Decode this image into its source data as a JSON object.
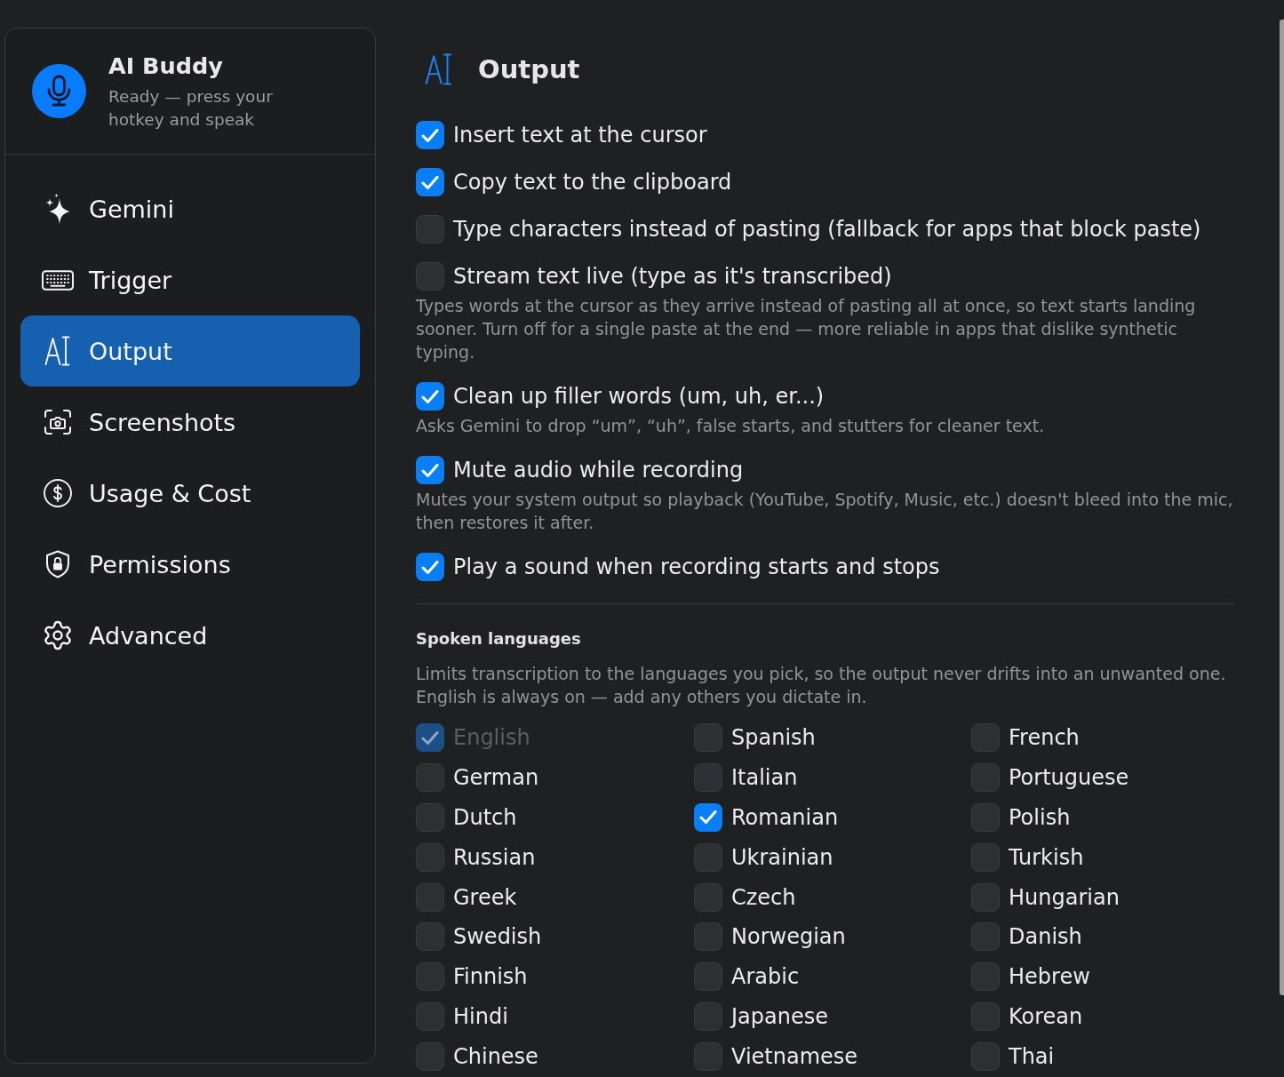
{
  "app": {
    "title": "AI Buddy",
    "status": "Ready — press your hotkey and speak"
  },
  "sidebar": {
    "items": [
      {
        "label": "Gemini",
        "selected": false
      },
      {
        "label": "Trigger",
        "selected": false
      },
      {
        "label": "Output",
        "selected": true
      },
      {
        "label": "Screenshots",
        "selected": false
      },
      {
        "label": "Usage & Cost",
        "selected": false
      },
      {
        "label": "Permissions",
        "selected": false
      },
      {
        "label": "Advanced",
        "selected": false
      }
    ]
  },
  "page": {
    "title": "Output"
  },
  "options": [
    {
      "label": "Insert text at the cursor",
      "checked": true
    },
    {
      "label": "Copy text to the clipboard",
      "checked": true
    },
    {
      "label": "Type characters instead of pasting (fallback for apps that block paste)",
      "checked": false
    },
    {
      "label": "Stream text live (type as it's transcribed)",
      "checked": false,
      "description": "Types words at the cursor as they arrive instead of pasting all at once, so text starts landing sooner. Turn off for a single paste at the end — more reliable in apps that dislike synthetic typing."
    },
    {
      "label": "Clean up filler words (um, uh, er...)",
      "checked": true,
      "description": "Asks Gemini to drop “um”, “uh”, false starts, and stutters for cleaner text."
    },
    {
      "label": "Mute audio while recording",
      "checked": true,
      "description": "Mutes your system output so playback (YouTube, Spotify, Music, etc.) doesn't bleed into the mic, then restores it after."
    },
    {
      "label": "Play a sound when recording starts and stops",
      "checked": true
    }
  ],
  "languages": {
    "title": "Spoken languages",
    "description": "Limits transcription to the languages you pick, so the output never drifts into an unwanted one. English is always on — add any others you dictate in.",
    "items": [
      {
        "label": "English",
        "checked": true,
        "disabled": true
      },
      {
        "label": "Spanish",
        "checked": false,
        "disabled": false
      },
      {
        "label": "French",
        "checked": false,
        "disabled": false
      },
      {
        "label": "German",
        "checked": false,
        "disabled": false
      },
      {
        "label": "Italian",
        "checked": false,
        "disabled": false
      },
      {
        "label": "Portuguese",
        "checked": false,
        "disabled": false
      },
      {
        "label": "Dutch",
        "checked": false,
        "disabled": false
      },
      {
        "label": "Romanian",
        "checked": true,
        "disabled": false
      },
      {
        "label": "Polish",
        "checked": false,
        "disabled": false
      },
      {
        "label": "Russian",
        "checked": false,
        "disabled": false
      },
      {
        "label": "Ukrainian",
        "checked": false,
        "disabled": false
      },
      {
        "label": "Turkish",
        "checked": false,
        "disabled": false
      },
      {
        "label": "Greek",
        "checked": false,
        "disabled": false
      },
      {
        "label": "Czech",
        "checked": false,
        "disabled": false
      },
      {
        "label": "Hungarian",
        "checked": false,
        "disabled": false
      },
      {
        "label": "Swedish",
        "checked": false,
        "disabled": false
      },
      {
        "label": "Norwegian",
        "checked": false,
        "disabled": false
      },
      {
        "label": "Danish",
        "checked": false,
        "disabled": false
      },
      {
        "label": "Finnish",
        "checked": false,
        "disabled": false
      },
      {
        "label": "Arabic",
        "checked": false,
        "disabled": false
      },
      {
        "label": "Hebrew",
        "checked": false,
        "disabled": false
      },
      {
        "label": "Hindi",
        "checked": false,
        "disabled": false
      },
      {
        "label": "Japanese",
        "checked": false,
        "disabled": false
      },
      {
        "label": "Korean",
        "checked": false,
        "disabled": false
      },
      {
        "label": "Chinese",
        "checked": false,
        "disabled": false
      },
      {
        "label": "Vietnamese",
        "checked": false,
        "disabled": false
      },
      {
        "label": "Thai",
        "checked": false,
        "disabled": false
      }
    ]
  }
}
